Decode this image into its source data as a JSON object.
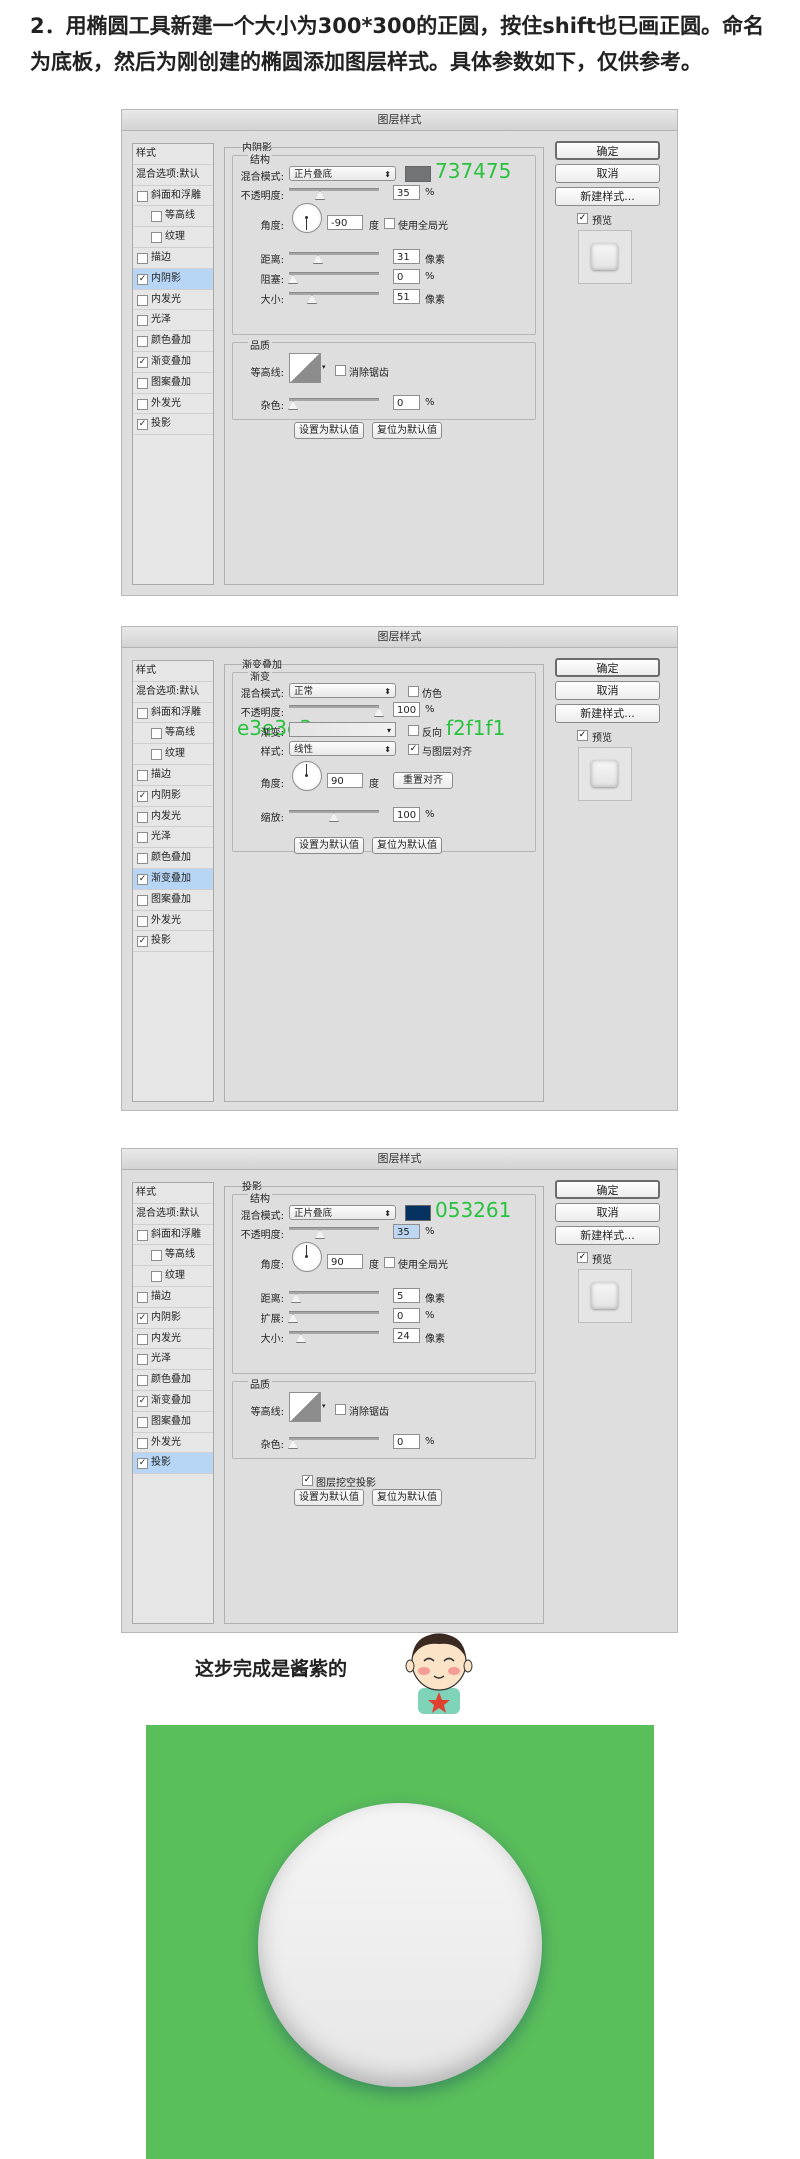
{
  "intro": "2．用椭圆工具新建一个大小为300*300的正圆，按住shift也已画正圆。命名为底板，然后为刚创建的椭圆添加图层样式。具体参数如下，仅供参考。",
  "dialog_title": "图层样式",
  "right_buttons": {
    "ok": "确定",
    "cancel": "取消",
    "new_style": "新建样式...",
    "preview": "预览"
  },
  "style_list": {
    "header": "样式",
    "blend_options": "混合选项:默认",
    "items": [
      "斜面和浮雕",
      "等高线",
      "纹理",
      "描边",
      "内阴影",
      "内发光",
      "光泽",
      "颜色叠加",
      "渐变叠加",
      "图案叠加",
      "外发光",
      "投影"
    ]
  },
  "dialog1": {
    "section": "内阴影",
    "group": "结构",
    "blend_mode_label": "混合模式:",
    "blend_mode": "正片叠底",
    "color_hex": "737475",
    "swatch_color": "#737475",
    "opacity_label": "不透明度:",
    "opacity": "35",
    "angle_label": "角度:",
    "angle": "-90",
    "degree": "度",
    "global_light": "使用全局光",
    "distance_label": "距离:",
    "distance": "31",
    "choke_label": "阻塞:",
    "choke": "0",
    "size_label": "大小:",
    "size": "51",
    "px": "像素",
    "pct": "%",
    "quality": "品质",
    "contour_label": "等高线:",
    "antialias": "消除锯齿",
    "noise_label": "杂色:",
    "noise": "0",
    "set_default": "设置为默认值",
    "reset_default": "复位为默认值"
  },
  "dialog2": {
    "section": "渐变叠加",
    "group": "渐变",
    "blend_mode_label": "混合模式:",
    "blend_mode": "正常",
    "dither": "仿色",
    "opacity_label": "不透明度:",
    "opacity": "100",
    "gradient_label": "渐变:",
    "reverse": "反向",
    "left_hex": "e3e3e3",
    "right_hex": "f2f1f1",
    "style_label": "样式:",
    "style": "线性",
    "align_layer": "与图层对齐",
    "angle_label": "角度:",
    "angle": "90",
    "degree": "度",
    "reset_align": "重置对齐",
    "scale_label": "缩放:",
    "scale": "100",
    "pct": "%",
    "set_default": "设置为默认值",
    "reset_default": "复位为默认值"
  },
  "dialog3": {
    "section": "投影",
    "group": "结构",
    "blend_mode_label": "混合模式:",
    "blend_mode": "正片叠底",
    "color_hex": "053261",
    "swatch_color": "#053261",
    "opacity_label": "不透明度:",
    "opacity": "35",
    "angle_label": "角度:",
    "angle": "90",
    "degree": "度",
    "global_light": "使用全局光",
    "distance_label": "距离:",
    "distance": "5",
    "spread_label": "扩展:",
    "spread": "0",
    "size_label": "大小:",
    "size": "24",
    "px": "像素",
    "pct": "%",
    "quality": "品质",
    "contour_label": "等高线:",
    "antialias": "消除锯齿",
    "noise_label": "杂色:",
    "noise": "0",
    "knockout": "图层挖空投影",
    "set_default": "设置为默认值",
    "reset_default": "复位为默认值"
  },
  "result_caption": "这步完成是酱紫的",
  "colors": {
    "green_bg": "#5abe5b",
    "accent_text": "#28c23e",
    "selected": "#b7d6f6"
  }
}
